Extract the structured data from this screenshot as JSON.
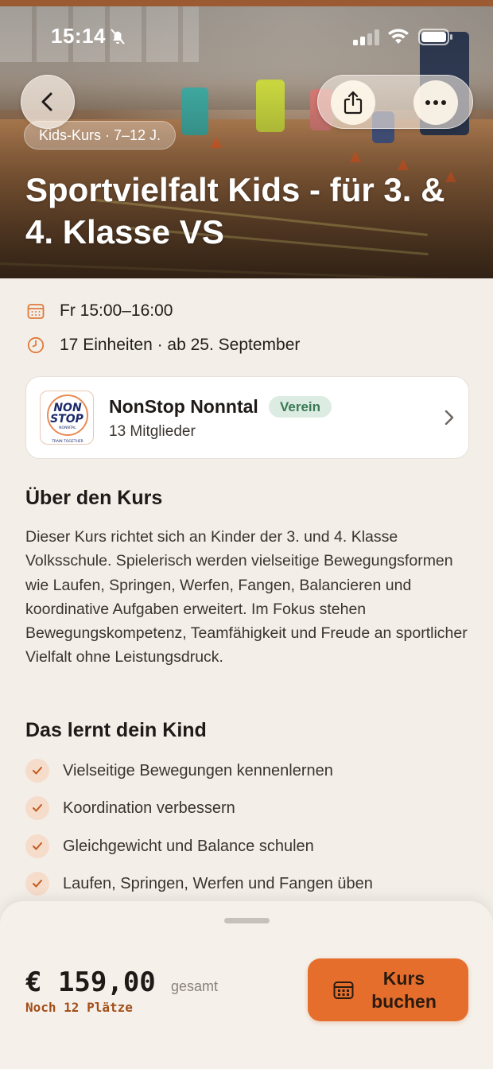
{
  "status_bar": {
    "time": "15:14"
  },
  "hero": {
    "category": "Kids-Kurs · 7–12 J.",
    "title": "Sportvielfalt Kids - für 3. & 4. Klasse VS"
  },
  "info": {
    "schedule": "Fr 15:00–16:00",
    "sessions": "17 Einheiten · ab 25. September"
  },
  "club": {
    "name": "NonStop Nonntal",
    "badge": "Verein",
    "members": "13 Mitglieder",
    "logo_text": [
      "NON",
      "STOP",
      "NONNTAL",
      "TRAIN TOGETHER"
    ]
  },
  "about": {
    "title": "Über den Kurs",
    "text": "Dieser Kurs richtet sich an Kinder der 3. und 4. Klasse Volksschule. Spielerisch werden vielseitige Bewegungsformen wie Laufen, Springen, Werfen, Fangen, Balancieren und koordinative Aufgaben erweitert. Im Fokus stehen Bewegungskompetenz, Teamfähigkeit und Freude an sportlicher Vielfalt ohne Leistungsdruck."
  },
  "learn": {
    "title": "Das lernt dein Kind",
    "items": [
      "Vielseitige Bewegungen kennenlernen",
      "Koordination verbessern",
      "Gleichgewicht und Balance schulen",
      "Laufen, Springen, Werfen und Fangen üben"
    ]
  },
  "booking": {
    "price": "€ 159,00",
    "price_suffix": "gesamt",
    "places": "Noch 12 Plätze",
    "button_label": "Kurs buchen"
  },
  "colors": {
    "accent": "#e66e2c",
    "background": "#f3efe8",
    "badge_bg": "#ddece3",
    "badge_text": "#3a7a55",
    "places_text": "#a34e19"
  },
  "icons": [
    "bell-slash-icon",
    "signal-icon",
    "wifi-icon",
    "battery-icon",
    "back-arrow-icon",
    "share-icon",
    "more-icon",
    "calendar-icon",
    "clock-icon",
    "chevron-right-icon",
    "check-icon"
  ]
}
